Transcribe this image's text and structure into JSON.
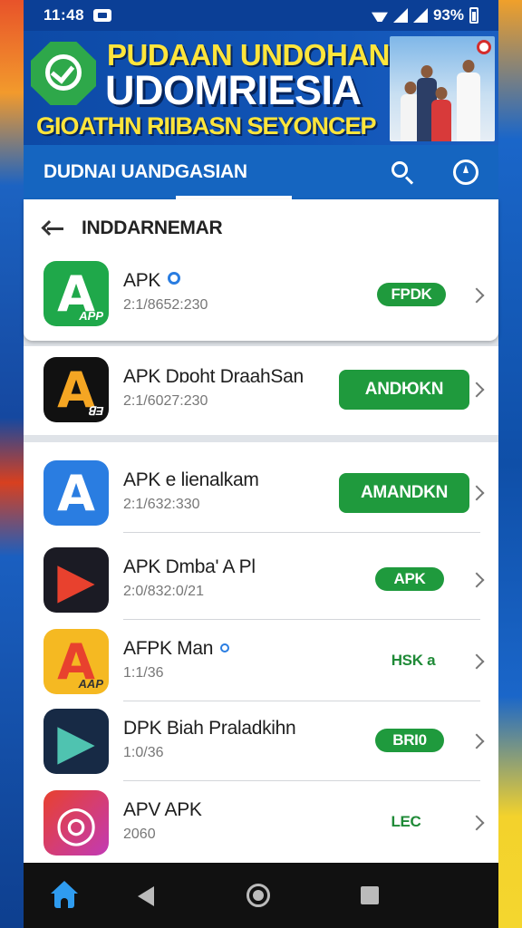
{
  "status_bar": {
    "time": "11:48",
    "battery_text": "93%"
  },
  "banner": {
    "line1": "PUDAAN UNDOHAN",
    "line2": "UDOMRIESIA",
    "line3": "GIOATHN RIIBASN SEYONCEP"
  },
  "app_bar": {
    "title": "DUDNAI UANDGASIAN"
  },
  "section": {
    "title": "INDDARNEMAR"
  },
  "apps": [
    {
      "name": "APK",
      "meta": "2:1/8652:230",
      "button": "FPDK",
      "verified": true,
      "icon_sub": "APP",
      "icon_letter": "A"
    },
    {
      "name": "APK Dɒoht DraahSan",
      "meta": "2:1/6027:230",
      "button": "ANDЮKN",
      "verified": false,
      "icon_sub": "ꓭƎ",
      "icon_letter": "A"
    },
    {
      "name": "APK e Ɩienalkam",
      "meta": "2:1/632:330",
      "button": "AMANDKN",
      "verified": false,
      "icon_sub": "",
      "icon_letter": "A"
    },
    {
      "name": "APK Dmba' A Pl",
      "meta": "2:0/832:0/21",
      "button": "APK",
      "verified": false,
      "icon_sub": "",
      "icon_letter": "▶"
    },
    {
      "name": "AFPK Man",
      "meta": "1:1/36",
      "button": "HSK a",
      "verified": true,
      "icon_sub": "AAP",
      "icon_letter": "A"
    },
    {
      "name": "DPK Biah Praladkihn",
      "meta": "1:0/36",
      "button": "BRI0",
      "verified": false,
      "icon_sub": "",
      "icon_letter": "▶"
    },
    {
      "name": "APV APK",
      "meta": "2060",
      "button": "LEC",
      "verified": false,
      "icon_sub": "",
      "icon_letter": "◎"
    }
  ],
  "colors": {
    "primary": "#1565c0",
    "banner_bg": "#0d4aa6",
    "button_green": "#1f9a3d",
    "banner_yellow": "#ffe53b",
    "nav_home": "#2f9cf0"
  },
  "icons": {
    "status_notification": "notification-icon",
    "status_wifi": "wifi-icon",
    "status_signal": "signal-icon",
    "status_battery": "battery-icon",
    "banner_logo": "check-badge-icon",
    "search": "search-icon",
    "compass": "compass-icon",
    "back": "back-arrow-icon",
    "chevron": "chevron-right-icon",
    "nav_home": "home-icon",
    "nav_back": "nav-back-icon",
    "nav_home_circle": "nav-home-circle-icon",
    "nav_recents": "recents-icon"
  }
}
